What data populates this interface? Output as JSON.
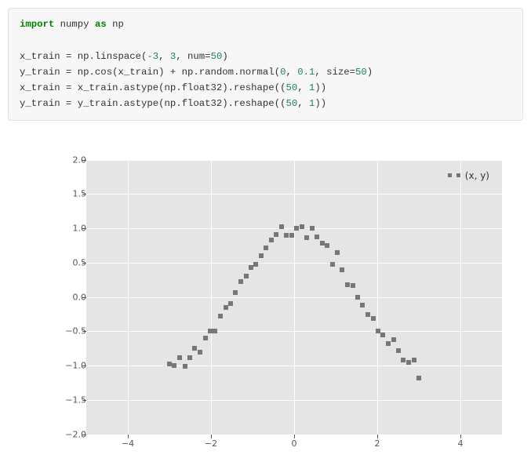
{
  "code": {
    "lines": [
      {
        "t": "import",
        "s1": " numpy ",
        "t2": "as",
        "s2": " np"
      },
      {
        "blank": true
      },
      {
        "raw": [
          "x_train = np.linspace(",
          "-3",
          ", ",
          "3",
          ", num=",
          "50",
          ")"
        ]
      },
      {
        "raw": [
          "y_train = np.cos(x_train) + np.random.normal(",
          "0",
          ", ",
          "0.1",
          ", size=",
          "50",
          ")"
        ]
      },
      {
        "raw": [
          "x_train = x_train.astype(np.float32).reshape((",
          "50",
          ", ",
          "1",
          "))"
        ]
      },
      {
        "raw": [
          "y_train = y_train.astype(np.float32).reshape((",
          "50",
          ", ",
          "1",
          "))"
        ]
      }
    ]
  },
  "chart_data": {
    "type": "scatter",
    "title": "",
    "xlabel": "",
    "ylabel": "",
    "xlim": [
      -5,
      5
    ],
    "ylim": [
      -2.0,
      2.0
    ],
    "xticks": [
      -4,
      -2,
      0,
      2,
      4
    ],
    "yticks": [
      -2.0,
      -1.5,
      -1.0,
      -0.5,
      0.0,
      0.5,
      1.0,
      1.5,
      2.0
    ],
    "legend": "(x, y)",
    "series": [
      {
        "name": "(x, y)",
        "x": [
          -3.0,
          -2.88,
          -2.76,
          -2.63,
          -2.51,
          -2.39,
          -2.27,
          -2.14,
          -2.02,
          -1.9,
          -1.78,
          -1.65,
          -1.53,
          -1.41,
          -1.29,
          -1.16,
          -1.04,
          -0.92,
          -0.8,
          -0.67,
          -0.55,
          -0.43,
          -0.31,
          -0.18,
          -0.06,
          0.06,
          0.18,
          0.31,
          0.43,
          0.55,
          0.67,
          0.8,
          0.92,
          1.04,
          1.16,
          1.29,
          1.41,
          1.53,
          1.65,
          1.78,
          1.9,
          2.02,
          2.14,
          2.27,
          2.39,
          2.51,
          2.63,
          2.76,
          2.88,
          3.0
        ],
        "y": [
          -0.98,
          -1.0,
          -0.88,
          -1.01,
          -0.88,
          -0.75,
          -0.8,
          -0.6,
          -0.5,
          -0.5,
          -0.28,
          -0.15,
          -0.1,
          0.07,
          0.22,
          0.3,
          0.43,
          0.48,
          0.6,
          0.72,
          0.83,
          0.91,
          1.02,
          0.9,
          0.9,
          1.0,
          1.03,
          0.86,
          1.0,
          0.88,
          0.78,
          0.75,
          0.48,
          0.65,
          0.4,
          0.18,
          0.17,
          0.0,
          -0.12,
          -0.25,
          -0.31,
          -0.5,
          -0.55,
          -0.68,
          -0.62,
          -0.78,
          -0.92,
          -0.95,
          -0.92,
          -1.18
        ]
      }
    ]
  },
  "ytick_labels": {
    "-2": "−2.0",
    "-1.5": "−1.5",
    "-1": "−1.0",
    "-0.5": "−0.5",
    "0": "0.0",
    "0.5": "0.5",
    "1": "1.0",
    "1.5": "1.5",
    "2": "2.0"
  },
  "xtick_labels": {
    "-4": "−4",
    "-2": "−2",
    "0": "0",
    "2": "2",
    "4": "4"
  }
}
